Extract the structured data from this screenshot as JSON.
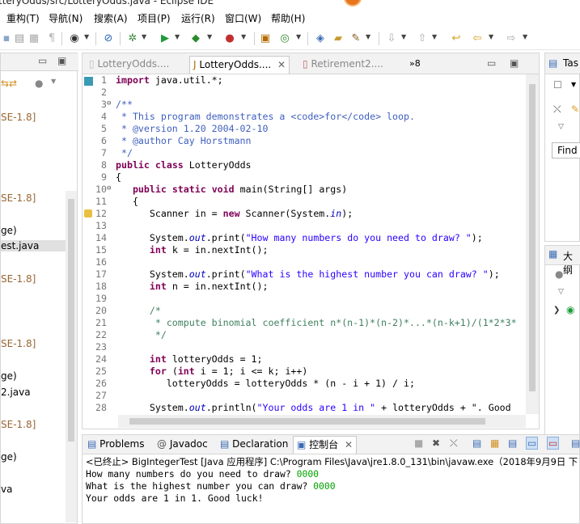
{
  "window": {
    "title": "tteryOdds/src/LotteryOdds.java - Eclipse IDE"
  },
  "menu": [
    "重构(T)",
    "导航(N)",
    "搜索(A)",
    "项目(P)",
    "运行(R)",
    "窗口(W)",
    "帮助(H)"
  ],
  "left_panel": {
    "items": [
      "SE-1.8]",
      "SE-1.8]",
      "ge)",
      "est.java",
      "SE-1.8]",
      "SE-1.8]",
      "ge)",
      "2.java",
      "SE-1.8]",
      "ge)",
      "va"
    ]
  },
  "editor": {
    "tabs": [
      "LotteryOdds....",
      "LotteryOdds....",
      "Retirement2....",
      "»8"
    ],
    "lines": [
      {
        "n": "1",
        "t": "import java.util.*;"
      },
      {
        "n": "2",
        "t": ""
      },
      {
        "n": "3",
        "t": "/**"
      },
      {
        "n": "4",
        "t": " * This program demonstrates a <code>for</code> loop."
      },
      {
        "n": "5",
        "t": " * @version 1.20 2004-02-10"
      },
      {
        "n": "6",
        "t": " * @author Cay Horstmann"
      },
      {
        "n": "7",
        "t": " */"
      },
      {
        "n": "8",
        "t": "public class LotteryOdds"
      },
      {
        "n": "9",
        "t": "{"
      },
      {
        "n": "10",
        "t": "   public static void main(String[] args)"
      },
      {
        "n": "11",
        "t": "   {"
      },
      {
        "n": "12",
        "t": "      Scanner in = new Scanner(System.in);"
      },
      {
        "n": "13",
        "t": ""
      },
      {
        "n": "14",
        "t": "      System.out.print(\"How many numbers do you need to draw? \");"
      },
      {
        "n": "15",
        "t": "      int k = in.nextInt();"
      },
      {
        "n": "16",
        "t": ""
      },
      {
        "n": "17",
        "t": "      System.out.print(\"What is the highest number you can draw? \");"
      },
      {
        "n": "18",
        "t": "      int n = in.nextInt();"
      },
      {
        "n": "19",
        "t": ""
      },
      {
        "n": "20",
        "t": "      /*"
      },
      {
        "n": "21",
        "t": "       * compute binomial coefficient n*(n-1)*(n-2)*...*(n-k+1)/(1*2*3*"
      },
      {
        "n": "22",
        "t": "       */"
      },
      {
        "n": "23",
        "t": ""
      },
      {
        "n": "24",
        "t": "      int lotteryOdds = 1;"
      },
      {
        "n": "25",
        "t": "      for (int i = 1; i <= k; i++)"
      },
      {
        "n": "26",
        "t": "         lotteryOdds = lotteryOdds * (n - i + 1) / i;"
      },
      {
        "n": "27",
        "t": ""
      },
      {
        "n": "28",
        "t": "      System.out.println(\"Your odds are 1 in \" + lotteryOdds + \". Good"
      }
    ]
  },
  "right_panel": {
    "tab1": "Tas",
    "find": "Find",
    "tab2": "大纲"
  },
  "console": {
    "tabs": [
      "Problems",
      "Javadoc",
      "Declaration",
      "控制台"
    ],
    "header": "<已终止> BigIntegerTest [Java 应用程序] C:\\Program Files\\Java\\jre1.8.0_131\\bin\\javaw.exe（2018年9月9日 下",
    "lines": [
      {
        "prompt": "How many numbers do you need to draw? ",
        "input": "0000"
      },
      {
        "prompt": "What is the highest number you can draw? ",
        "input": "0000"
      },
      {
        "prompt": "Your odds are 1 in 1. Good luck!",
        "input": ""
      }
    ]
  }
}
